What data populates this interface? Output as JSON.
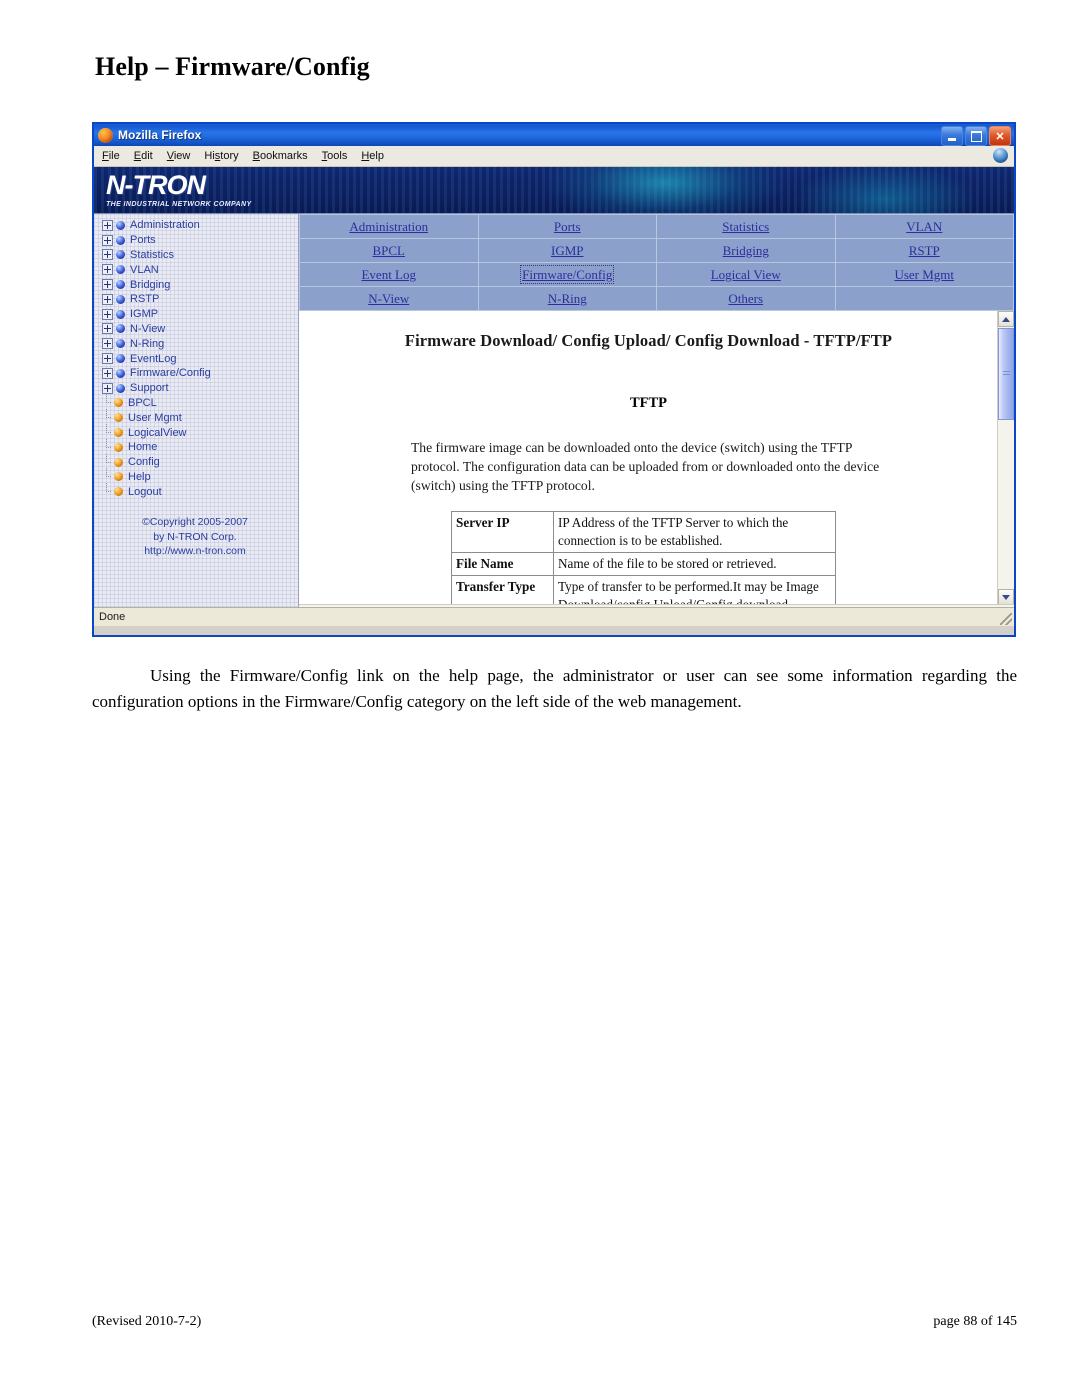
{
  "document": {
    "title": "Help – Firmware/Config",
    "body_paragraph": "Using the Firmware/Config link on the help page, the administrator or user can see some information regarding the configuration options in the Firmware/Config category on the left side of the web management.",
    "footer_left": "(Revised 2010-7-2)",
    "footer_right": "page 88 of 145"
  },
  "browser": {
    "window_title": "Mozilla Firefox",
    "menu": [
      "File",
      "Edit",
      "View",
      "History",
      "Bookmarks",
      "Tools",
      "Help"
    ],
    "window_buttons": {
      "minimize": "Minimize",
      "maximize": "Maximize",
      "close": "Close"
    },
    "status": "Done"
  },
  "banner": {
    "logo_text": "N-TRON",
    "tagline": "THE INDUSTRIAL NETWORK COMPANY"
  },
  "sidebar": {
    "tree": [
      {
        "label": "Administration",
        "type": "branch"
      },
      {
        "label": "Ports",
        "type": "branch"
      },
      {
        "label": "Statistics",
        "type": "branch"
      },
      {
        "label": "VLAN",
        "type": "branch"
      },
      {
        "label": "Bridging",
        "type": "branch"
      },
      {
        "label": "RSTP",
        "type": "branch"
      },
      {
        "label": "IGMP",
        "type": "branch"
      },
      {
        "label": "N-View",
        "type": "branch"
      },
      {
        "label": "N-Ring",
        "type": "branch"
      },
      {
        "label": "EventLog",
        "type": "branch"
      },
      {
        "label": "Firmware/Config",
        "type": "branch"
      },
      {
        "label": "Support",
        "type": "branch"
      },
      {
        "label": "BPCL",
        "type": "leaf"
      },
      {
        "label": "User Mgmt",
        "type": "leaf"
      },
      {
        "label": "LogicalView",
        "type": "leaf"
      },
      {
        "label": "Home",
        "type": "leaf"
      },
      {
        "label": "Config",
        "type": "leaf"
      },
      {
        "label": "Help",
        "type": "leaf"
      },
      {
        "label": "Logout",
        "type": "leaf"
      }
    ],
    "copyright_line1": "©Copyright 2005-2007",
    "copyright_line2": "by N-TRON Corp.",
    "copyright_line3": "http://www.n-tron.com"
  },
  "nav_table": {
    "rows": [
      [
        "Administration",
        "Ports",
        "Statistics",
        "VLAN"
      ],
      [
        "BPCL",
        "IGMP",
        "Bridging",
        "RSTP"
      ],
      [
        "Event Log",
        "Firmware/Config",
        "Logical View",
        "User Mgmt"
      ],
      [
        "N-View",
        "N-Ring",
        "Others",
        ""
      ]
    ],
    "focused": "Firmware/Config"
  },
  "content": {
    "heading_main": "Firmware Download/ Config Upload/ Config Download",
    "heading_tail": "- TFTP/FTP",
    "section_title": "TFTP",
    "paragraph": "The firmware image can be downloaded onto the device (switch) using the TFTP protocol. The configuration data can be uploaded from or downloaded onto the device (switch) using the TFTP protocol.",
    "definitions": [
      {
        "term": "Server IP",
        "desc": "IP Address of the TFTP Server to which the connection is to be established."
      },
      {
        "term": "File Name",
        "desc": "Name of the file to be stored or retrieved."
      },
      {
        "term": "Transfer Type",
        "desc": "Type of transfer to be performed.It may be Image Download/config Upload/Config download."
      }
    ]
  },
  "colors": {
    "titlebar_blue": "#1458d0",
    "banner_navy": "#0d1f62",
    "nav_table_bg": "#8ca0cc",
    "link_blue": "#2d2d9e",
    "tree_text": "#2a3ea0",
    "bullet_blue": "#1b2da8",
    "bullet_gold": "#f2a52a"
  }
}
